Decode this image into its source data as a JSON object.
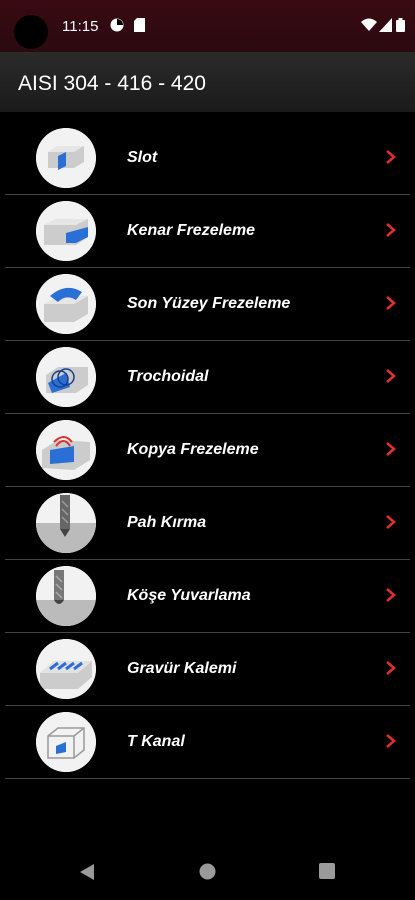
{
  "status_bar": {
    "time": "11:15"
  },
  "header": {
    "title": "AISI 304 - 416 - 420"
  },
  "list": [
    {
      "label": "Slot",
      "icon": "slot-icon"
    },
    {
      "label": "Kenar Frezeleme",
      "icon": "side-milling-icon"
    },
    {
      "label": "Son Yüzey Frezeleme",
      "icon": "face-milling-icon"
    },
    {
      "label": "Trochoidal",
      "icon": "trochoidal-icon"
    },
    {
      "label": "Kopya Frezeleme",
      "icon": "copy-milling-icon"
    },
    {
      "label": "Pah Kırma",
      "icon": "chamfer-icon"
    },
    {
      "label": "Köşe Yuvarlama",
      "icon": "corner-rounding-icon"
    },
    {
      "label": "Gravür Kalemi",
      "icon": "engraving-icon"
    },
    {
      "label": "T Kanal",
      "icon": "t-slot-icon"
    }
  ],
  "colors": {
    "accent": "#e03030",
    "background": "#000000",
    "status_bar": "#3a0a12"
  }
}
